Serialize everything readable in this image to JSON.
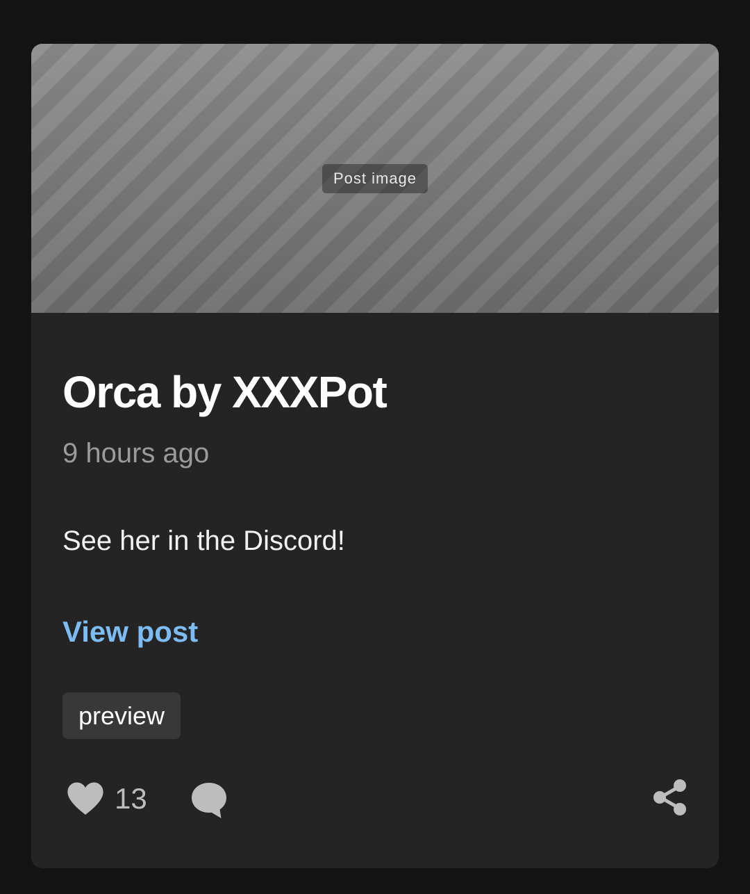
{
  "post": {
    "image_label": "Post image",
    "title": "Orca by XXXPot",
    "timestamp": "9 hours ago",
    "body": "See her in the Discord!",
    "view_post_label": "View post",
    "tags": [
      "preview"
    ],
    "like_count": "13"
  },
  "colors": {
    "page_bg": "#131313",
    "card_bg": "#242424",
    "link": "#7cbcf2",
    "muted": "#9b9b9b",
    "icon": "#bdbdbd",
    "tag_bg": "#383838"
  },
  "icons": {
    "like": "heart-icon",
    "comment": "comment-icon",
    "share": "share-icon"
  }
}
